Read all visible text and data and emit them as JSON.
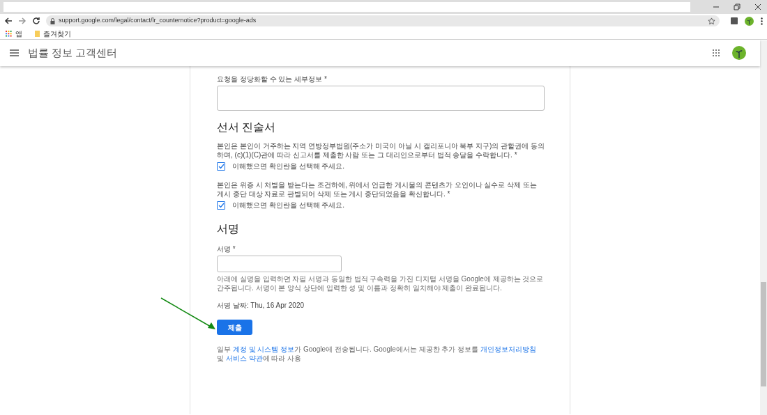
{
  "browser": {
    "url": "support.google.com/legal/contact/lr_counternotice?product=google-ads",
    "bookmarks": [
      {
        "kind": "apps",
        "label": "앱"
      },
      {
        "kind": "folder",
        "label": "즐겨찾기"
      }
    ]
  },
  "header": {
    "title": "법률 정보 고객센터"
  },
  "form": {
    "details": {
      "label": "요청을 정당화할 수 있는 세부정보 *"
    },
    "statement_heading": "선서 진술서",
    "statements": [
      {
        "text": "본인은 본인이 거주하는 지역 연방정부법원(주소가 미국이 아닐 시 캘리포니아 북부 지구)의 관할권에 동의하며, (c)(1)(C)관에 따라 신고서를 제출한 사람 또는 그 대리인으로부터 법적 송달을 수락합니다. *",
        "checkbox_label": "이해했으면 확인란을 선택해 주세요.",
        "checked": true
      },
      {
        "text": "본인은 위증 시 처벌을 받는다는 조건하에, 위에서 언급한 게시물의 콘텐츠가 오인이나 실수로 삭제 또는 게시 중단 대상 자료로 판별되어 삭제 또는 게시 중단되었음을 확신합니다. *",
        "checkbox_label": "이해했으면 확인란을 선택해 주세요.",
        "checked": true
      }
    ],
    "signature_heading": "서명",
    "signature": {
      "label": "서명 *",
      "help": "아래에 실명을 입력하면 자필 서명과 동일한 법적 구속력을 가진 디지털 서명을 Google에 제공하는 것으로 간주됩니다. 서명이 본 양식 상단에 입력한 성 및 이름과 정확히 일치해야 제출이 완료됩니다."
    },
    "signature_date": "서명 날짜: Thu, 16 Apr 2020",
    "submit": "제출",
    "footer": [
      {
        "kind": "text",
        "text": "일부 "
      },
      {
        "kind": "link",
        "text": "계정 및 시스템 정보"
      },
      {
        "kind": "text",
        "text": "가 Google에 전송됩니다. Google에서는 제공한 추가 정보를 "
      },
      {
        "kind": "link",
        "text": "개인정보처리방침"
      },
      {
        "kind": "text",
        "text": " 및 "
      },
      {
        "kind": "link",
        "text": "서비스 약관"
      },
      {
        "kind": "text",
        "text": "에 따라 사용"
      }
    ]
  }
}
